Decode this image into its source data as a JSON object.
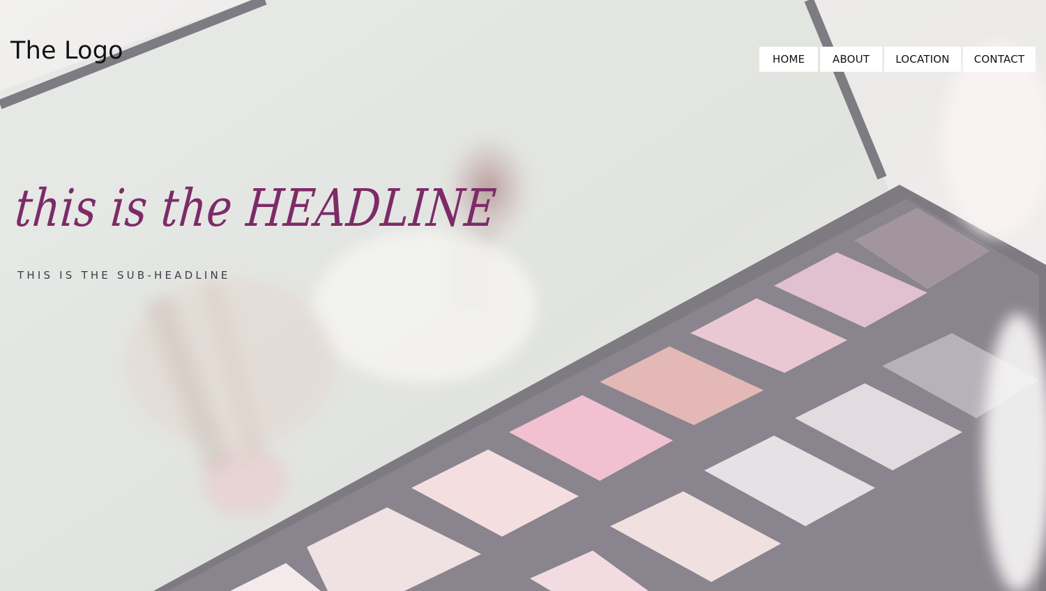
{
  "header": {
    "logo_text": "The Logo"
  },
  "nav": {
    "items": [
      {
        "label": "HOME"
      },
      {
        "label": "ABOUT"
      },
      {
        "label": "LOCATION"
      },
      {
        "label": "CONTACT"
      }
    ]
  },
  "hero": {
    "headline": "this is the HEADLINE",
    "subheadline": "THIS IS THE SUB-HEADLINE",
    "image_subject": "eyeshadow palette with makeup brush reflected in mirror",
    "headline_color": "#7d2b68"
  }
}
